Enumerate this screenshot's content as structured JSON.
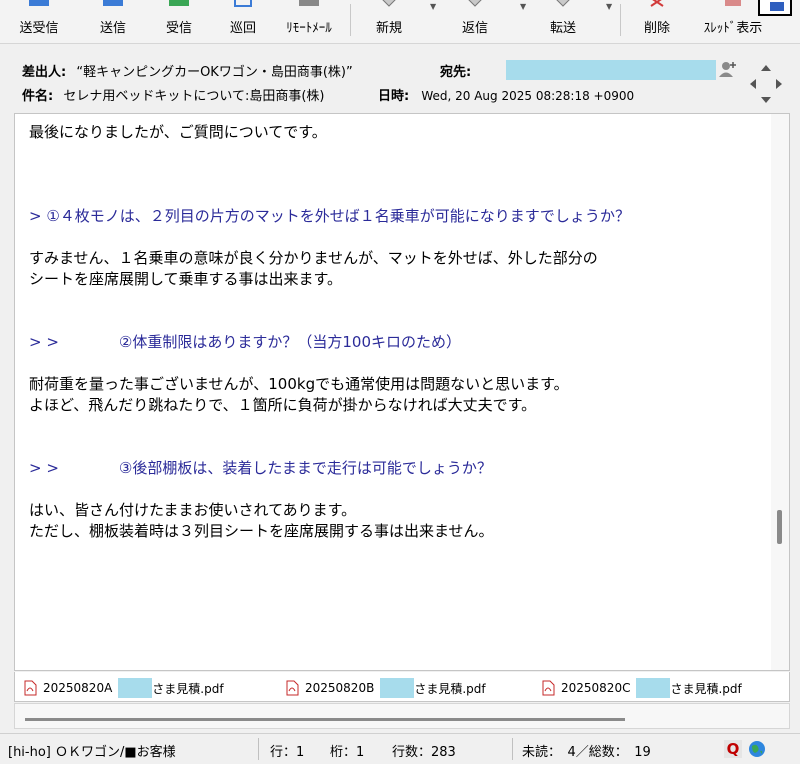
{
  "toolbar": {
    "buttons": [
      {
        "label": "送受信",
        "icon": "send-receive-icon"
      },
      {
        "label": "送信",
        "icon": "send-icon"
      },
      {
        "label": "受信",
        "icon": "receive-icon"
      },
      {
        "label": "巡回",
        "icon": "patrol-icon"
      },
      {
        "label": "ﾘﾓｰﾄﾒｰﾙ",
        "icon": "remote-mail-icon"
      },
      {
        "label": "新規",
        "icon": "new-mail-icon"
      },
      {
        "label": "返信",
        "icon": "reply-icon"
      },
      {
        "label": "転送",
        "icon": "forward-icon"
      },
      {
        "label": "削除",
        "icon": "delete-icon"
      },
      {
        "label": "ｽﾚｯﾄﾞ表示",
        "icon": "thread-view-icon"
      }
    ]
  },
  "header": {
    "from_label": "差出人:",
    "from_value": "“軽キャンピングカーOKワゴン・島田商事(株)”",
    "to_label": "宛先:",
    "subject_label": "件名:",
    "subject_value": "セレナ用ベッドキットについて:島田商事(株)",
    "date_label": "日時:",
    "date_value": "Wed, 20 Aug 2025 08:28:18 +0900"
  },
  "message": {
    "lines": [
      {
        "text": "最後になりましたが、ご質問についてです。",
        "quote": false
      },
      {
        "text": "",
        "quote": false
      },
      {
        "text": "",
        "quote": false
      },
      {
        "text": "",
        "quote": false
      },
      {
        "text": "> ①４枚モノは、２列目の片方のマットを外せば１名乗車が可能になりますでしょうか？",
        "quote": true
      },
      {
        "text": "",
        "quote": false
      },
      {
        "text": "すみません、１名乗車の意味が良く分かりませんが、マットを外せば、外した部分の",
        "quote": false
      },
      {
        "text": "シートを座席展開して乗車する事は出来ます。",
        "quote": false
      },
      {
        "text": "",
        "quote": false
      },
      {
        "text": "",
        "quote": false
      },
      {
        "text": "> >　　　　②体重制限はありますか？（当方100キロのため）",
        "quote": true
      },
      {
        "text": "",
        "quote": false
      },
      {
        "text": "耐荷重を量った事ございませんが、100kgでも通常使用は問題ないと思います。",
        "quote": false
      },
      {
        "text": "よほど、飛んだり跳ねたりで、１箇所に負荷が掛からなければ大丈夫です。",
        "quote": false
      },
      {
        "text": "",
        "quote": false
      },
      {
        "text": "",
        "quote": false
      },
      {
        "text": "> >　　　　③後部棚板は、装着したままで走行は可能でしょうか？",
        "quote": true
      },
      {
        "text": "",
        "quote": false
      },
      {
        "text": "はい、皆さん付けたままお使いされてあります。",
        "quote": false
      },
      {
        "text": "ただし、棚板装着時は３列目シートを座席展開する事は出来ません。",
        "quote": false
      }
    ]
  },
  "attachments": [
    {
      "prefix": "20250820A",
      "suffix": "さま見積.pdf"
    },
    {
      "prefix": "20250820B",
      "suffix": "さま見積.pdf"
    },
    {
      "prefix": "20250820C",
      "suffix": "さま見積.pdf"
    }
  ],
  "status": {
    "folder": "[hi-ho] ＯＫワゴン/■お客様",
    "row": "行：1",
    "col": "桁：1",
    "line_count": "行数：283",
    "unread": "未読：　4／総数：　19",
    "q_badge": "Q"
  },
  "colors": {
    "quote": "#2b2b99",
    "redaction": "#a7dcec",
    "q_badge": "#c00000"
  }
}
